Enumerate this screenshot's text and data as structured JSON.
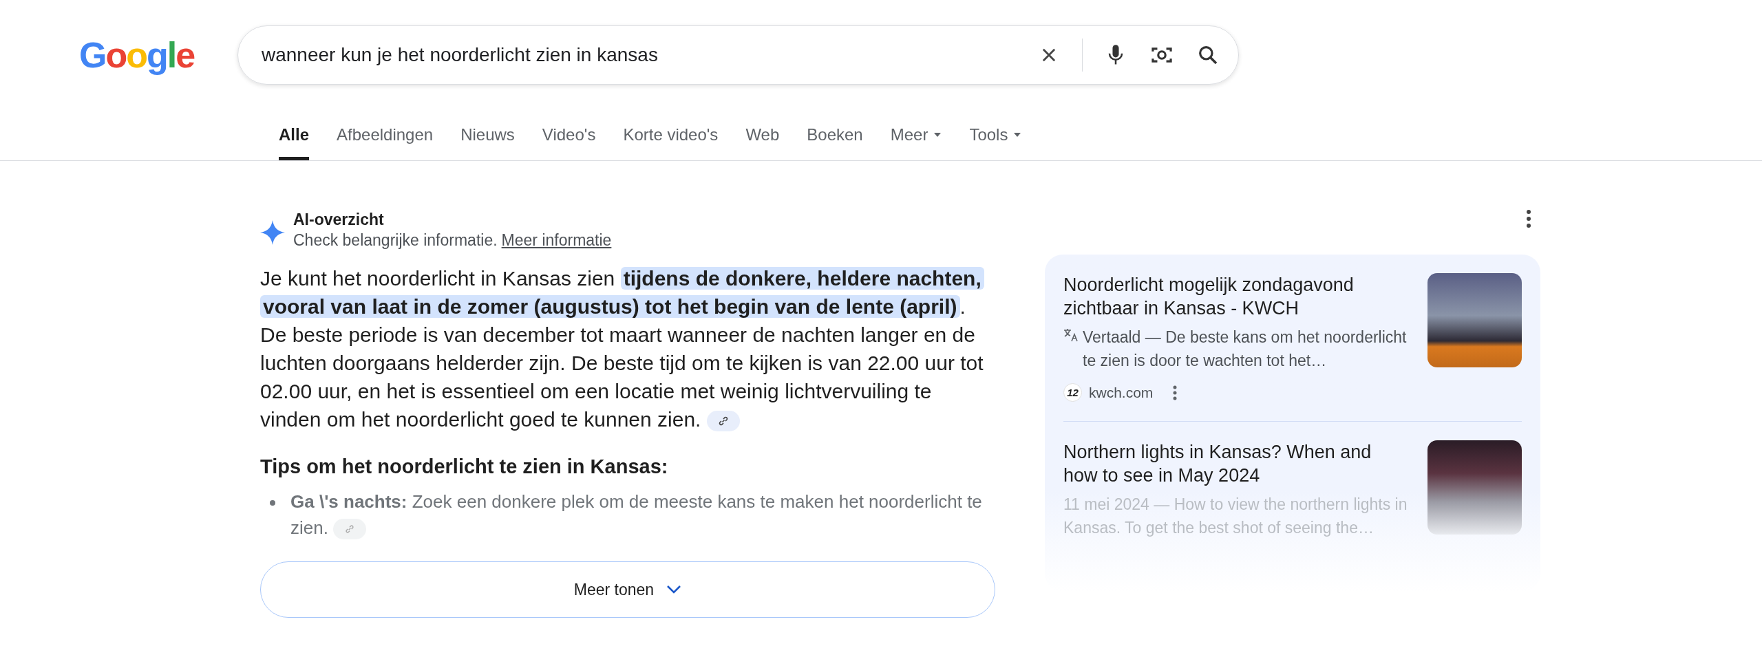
{
  "logo": "Google",
  "search": {
    "value": "wanneer kun je het noorderlicht zien in kansas"
  },
  "tabs": [
    {
      "label": "Alle",
      "selected": true,
      "kind": "plain"
    },
    {
      "label": "Afbeeldingen",
      "selected": false,
      "kind": "plain"
    },
    {
      "label": "Nieuws",
      "selected": false,
      "kind": "plain"
    },
    {
      "label": "Video's",
      "selected": false,
      "kind": "plain"
    },
    {
      "label": "Korte video's",
      "selected": false,
      "kind": "plain"
    },
    {
      "label": "Web",
      "selected": false,
      "kind": "plain"
    },
    {
      "label": "Boeken",
      "selected": false,
      "kind": "plain"
    },
    {
      "label": "Meer",
      "selected": false,
      "kind": "dropdown"
    },
    {
      "label": "Tools",
      "selected": false,
      "kind": "dropdown"
    }
  ],
  "ai_overview": {
    "title": "AI-overzicht",
    "subtitle": "Check belangrijke informatie.",
    "link": "Meer informatie",
    "lead": "Je kunt het noorderlicht in Kansas zien",
    "highlight": "tijdens de donkere, heldere nachten, vooral van laat in de zomer (augustus) tot het begin van de lente (april)",
    "rest": ". De beste periode is van december tot maart wanneer de nachten langer en de luchten doorgaans helderder zijn. De beste tijd om te kijken is van 22.00 uur tot 02.00 uur, en het is essentieel om een locatie met weinig lichtvervuiling te vinden om het noorderlicht goed te kunnen zien.",
    "tips_heading": "Tips om het noorderlicht te zien in Kansas:",
    "tips": [
      {
        "text": "**Ga \\'s nachts:** Zoek een donkere plek om de meeste kans te maken het noorderlicht te zien."
      }
    ],
    "more_button": "Meer tonen"
  },
  "sources": [
    {
      "title": "Noorderlicht mogelijk zondagavond zichtbaar in Kansas - KWCH",
      "translated": true,
      "snippet": "Vertaald — De beste kans om het noorderlicht te zien is door te wachten tot het…",
      "favicon_text": "12",
      "site": "kwch.com",
      "faded": false
    },
    {
      "title": "Northern lights in Kansas? When and how to see in May 2024",
      "translated": false,
      "snippet": "11 mei 2024 — How to view the northern lights in Kansas. To get the best shot of seeing the…",
      "faded": true
    }
  ]
}
